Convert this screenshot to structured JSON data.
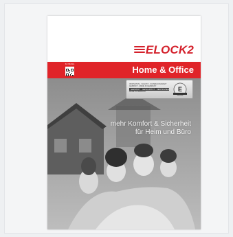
{
  "brand": {
    "logo_text": "ELOCK2",
    "color": "#d4202b"
  },
  "band": {
    "title": "Home & Office",
    "color": "#e02429",
    "qr_caption": "Zur Website"
  },
  "badge": {
    "lines": [
      "INNOVATIVE · SCHUTZ · ZUVERLÄSSIGKEIT",
      "GEPRÜFT · MADE IN GERMANY"
    ],
    "strip": "GEPRÜFT · GESCHÜTZT · ZERTIFIZIERT",
    "made": "MADE IN GERMANY"
  },
  "tagline": {
    "line1": "mehr Komfort & Sicherheit",
    "line2": "für Heim und Büro"
  }
}
